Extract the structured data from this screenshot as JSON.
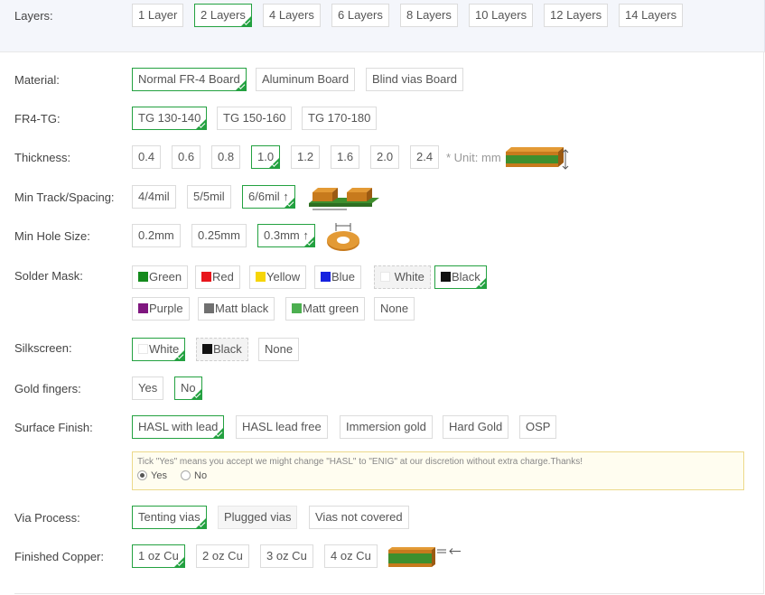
{
  "layers": {
    "label": "Layers:",
    "options": [
      "1 Layer",
      "2 Layers",
      "4 Layers",
      "6 Layers",
      "8 Layers",
      "10 Layers",
      "12 Layers",
      "14 Layers"
    ],
    "selected": "2 Layers"
  },
  "material": {
    "label": "Material:",
    "options": [
      "Normal FR-4 Board",
      "Aluminum Board",
      "Blind vias Board"
    ],
    "selected": "Normal FR-4 Board"
  },
  "fr4tg": {
    "label": "FR4-TG:",
    "options": [
      "TG 130-140",
      "TG 150-160",
      "TG 170-180"
    ],
    "selected": "TG 130-140"
  },
  "thickness": {
    "label": "Thickness:",
    "options": [
      "0.4",
      "0.6",
      "0.8",
      "1.0",
      "1.2",
      "1.6",
      "2.0",
      "2.4"
    ],
    "selected": "1.0",
    "unit_note": "* Unit: mm"
  },
  "track": {
    "label": "Min Track/Spacing:",
    "options": [
      "4/4mil",
      "5/5mil",
      "6/6mil ↑"
    ],
    "selected": "6/6mil ↑"
  },
  "hole": {
    "label": "Min Hole Size:",
    "options": [
      "0.2mm",
      "0.25mm",
      "0.3mm ↑"
    ],
    "selected": "0.3mm ↑"
  },
  "solder": {
    "label": "Solder Mask:",
    "options": [
      {
        "text": "Green",
        "color": "#138a1c"
      },
      {
        "text": "Red",
        "color": "#e8161c"
      },
      {
        "text": "Yellow",
        "color": "#f6d507"
      },
      {
        "text": "Blue",
        "color": "#1622df"
      },
      {
        "text": "White",
        "color": "#ffffff"
      },
      {
        "text": "Black",
        "color": "#111111"
      },
      {
        "text": "Purple",
        "color": "#7f177f"
      },
      {
        "text": "Matt black",
        "color": "#707070"
      },
      {
        "text": "Matt green",
        "color": "#4caf50"
      },
      {
        "text": "None",
        "color": ""
      }
    ],
    "selected": "Black"
  },
  "silk": {
    "label": "Silkscreen:",
    "options": [
      {
        "text": "White",
        "color": "#ffffff"
      },
      {
        "text": "Black",
        "color": "#111111"
      },
      {
        "text": "None",
        "color": ""
      }
    ],
    "selected": "White"
  },
  "gold": {
    "label": "Gold fingers:",
    "options": [
      "Yes",
      "No"
    ],
    "selected": "No"
  },
  "surface": {
    "label": "Surface Finish:",
    "options": [
      "HASL with lead",
      "HASL lead free",
      "Immersion gold",
      "Hard Gold",
      "OSP"
    ],
    "selected": "HASL with lead",
    "note": "Tick \"Yes\" means you accept we might change \"HASL\" to \"ENIG\" at our discretion without extra charge.Thanks!",
    "radio_yes": "Yes",
    "radio_no": "No",
    "radio_selected": "Yes"
  },
  "via": {
    "label": "Via Process:",
    "options": [
      "Tenting vias",
      "Plugged vias",
      "Vias not covered"
    ],
    "selected": "Tenting vias"
  },
  "copper": {
    "label": "Finished Copper:",
    "options": [
      "1 oz Cu",
      "2 oz Cu",
      "3 oz Cu",
      "4 oz Cu"
    ],
    "selected": "1 oz Cu"
  },
  "colors": {
    "selected_border": "#23a140",
    "note_bg": "#fffdf0",
    "note_border": "#ecd98a"
  }
}
